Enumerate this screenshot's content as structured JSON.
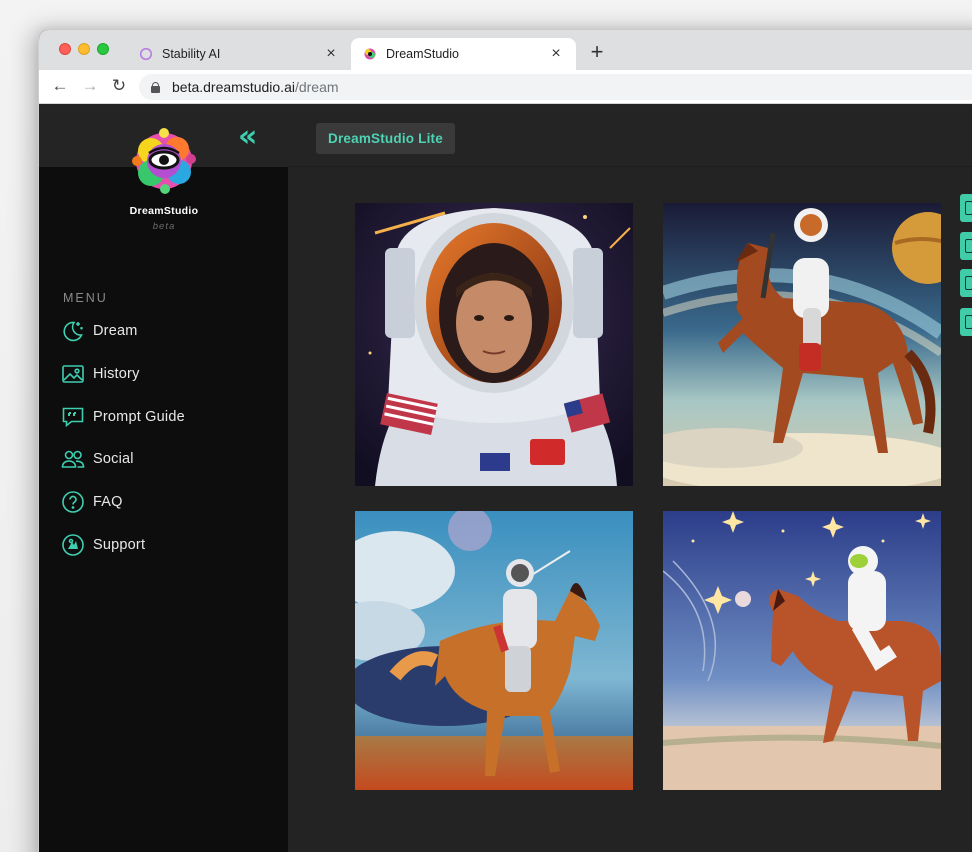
{
  "browser": {
    "tabs": [
      {
        "title": "Stability AI",
        "close": "×",
        "active": false
      },
      {
        "title": "DreamStudio",
        "close": "×",
        "active": true
      }
    ],
    "new_tab": "+",
    "url_host": "beta.dreamstudio.ai",
    "url_path": "/dream"
  },
  "sidebar": {
    "collapse_icon": "«",
    "brand": "DreamStudio",
    "beta": "beta",
    "menu_title": "MENU",
    "items": [
      {
        "label": "Dream",
        "icon": "moon-stars-icon"
      },
      {
        "label": "History",
        "icon": "image-gallery-icon"
      },
      {
        "label": "Prompt Guide",
        "icon": "quote-bubble-icon"
      },
      {
        "label": "Social",
        "icon": "people-icon"
      },
      {
        "label": "FAQ",
        "icon": "question-icon"
      },
      {
        "label": "Support",
        "icon": "support-icon"
      }
    ]
  },
  "header": {
    "lite_button": "DreamStudio Lite"
  },
  "gallery": {
    "images": [
      {
        "subject": "astronaut portrait"
      },
      {
        "subject": "astronaut riding horse in space"
      },
      {
        "subject": "astronaut riding horse in desert"
      },
      {
        "subject": "astronaut riding horse on starry plain"
      }
    ]
  },
  "colors": {
    "accent": "#3ecfb0",
    "sidebar_bg": "#0d0d0d",
    "main_bg": "#232323"
  }
}
